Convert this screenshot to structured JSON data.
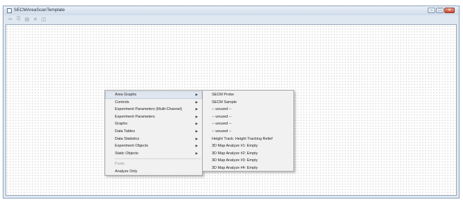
{
  "window": {
    "title": "SECMAreaScanTemplate",
    "controls": [
      "–",
      "□",
      "✕"
    ]
  },
  "toolbar": {
    "icons": [
      "cut-icon",
      "copy-icon",
      "paste-icon",
      "delete-icon",
      "properties-icon"
    ],
    "glyphs": [
      "✂",
      "⎘",
      "▤",
      "✕",
      "◫"
    ]
  },
  "context_menu": {
    "items": [
      {
        "label": "Area Graphs",
        "submenu": true,
        "selected": true
      },
      {
        "label": "Controls",
        "submenu": true
      },
      {
        "label": "Experiment Parameters (Multi-Channel)",
        "submenu": true
      },
      {
        "label": "Experiment Parameters",
        "submenu": true
      },
      {
        "label": "Graphs",
        "submenu": true
      },
      {
        "label": "Data Tables",
        "submenu": true
      },
      {
        "label": "Data Statistics",
        "submenu": true
      },
      {
        "label": "Experiment Objects",
        "submenu": true
      },
      {
        "label": "Static Objects",
        "submenu": true
      }
    ],
    "paste_label": "Paste",
    "analyze_label": "Analyze Only",
    "arrow": "▶"
  },
  "submenu": {
    "items": [
      "SECM Probe",
      "SECM Sample",
      "-- unused --",
      "-- unused --",
      "-- unused --",
      "-- unused --",
      "Height Track: Height Tracking Relief",
      "3D Map Analyze #1: Empty",
      "3D Map Analyze #2: Empty",
      "3D Map Analyze #3: Empty",
      "3D Map Analyze #4: Empty"
    ]
  }
}
